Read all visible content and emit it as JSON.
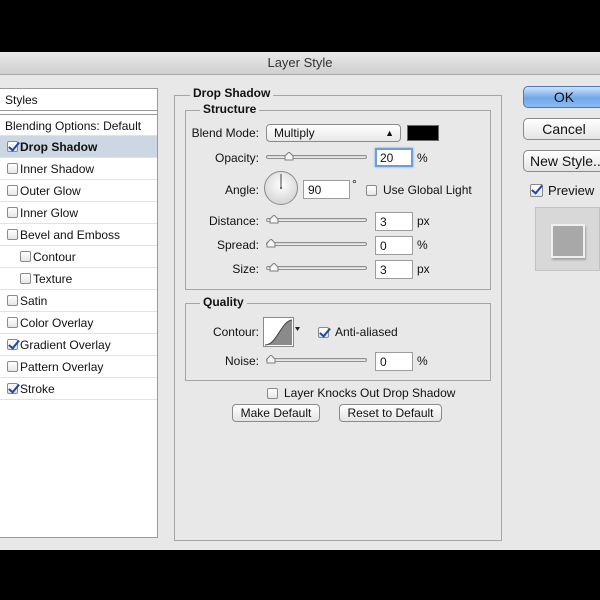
{
  "window": {
    "title": "Layer Style"
  },
  "sidebar": {
    "header": "Styles",
    "blending": "Blending Options: Default",
    "items": [
      {
        "label": "Drop Shadow",
        "checked": true,
        "selected": true
      },
      {
        "label": "Inner Shadow",
        "checked": false
      },
      {
        "label": "Outer Glow",
        "checked": false
      },
      {
        "label": "Inner Glow",
        "checked": false
      },
      {
        "label": "Bevel and Emboss",
        "checked": false
      },
      {
        "label": "Contour",
        "checked": false,
        "sub": true
      },
      {
        "label": "Texture",
        "checked": false,
        "sub": true
      },
      {
        "label": "Satin",
        "checked": false
      },
      {
        "label": "Color Overlay",
        "checked": false
      },
      {
        "label": "Gradient Overlay",
        "checked": true
      },
      {
        "label": "Pattern Overlay",
        "checked": false
      },
      {
        "label": "Stroke",
        "checked": true
      }
    ]
  },
  "main": {
    "title": "Drop Shadow",
    "structure": {
      "title": "Structure",
      "blend_mode": {
        "label": "Blend Mode:",
        "value": "Multiply",
        "color": "#000000"
      },
      "opacity": {
        "label": "Opacity:",
        "value": "20",
        "unit": "%",
        "level": 0.2
      },
      "angle": {
        "label": "Angle:",
        "value": "90",
        "unit": "°",
        "degrees": 90
      },
      "use_global_light": {
        "label": "Use Global Light",
        "checked": false
      },
      "distance": {
        "label": "Distance:",
        "value": "3",
        "unit": "px",
        "level": 0.03
      },
      "spread": {
        "label": "Spread:",
        "value": "0",
        "unit": "%",
        "level": 0
      },
      "size": {
        "label": "Size:",
        "value": "3",
        "unit": "px",
        "level": 0.03
      }
    },
    "quality": {
      "title": "Quality",
      "contour": {
        "label": "Contour:"
      },
      "anti_aliased": {
        "label": "Anti-aliased",
        "checked": true
      },
      "noise": {
        "label": "Noise:",
        "value": "0",
        "unit": "%",
        "level": 0
      }
    },
    "knocks_out": {
      "label": "Layer Knocks Out Drop Shadow",
      "checked": false
    },
    "make_default": "Make Default",
    "reset_default": "Reset to Default"
  },
  "actions": {
    "ok": "OK",
    "cancel": "Cancel",
    "new_style": "New Style...",
    "preview": {
      "label": "Preview",
      "checked": true
    }
  },
  "colors": {
    "accent": "#6fa7ea",
    "selection": "#cdd6e3"
  }
}
